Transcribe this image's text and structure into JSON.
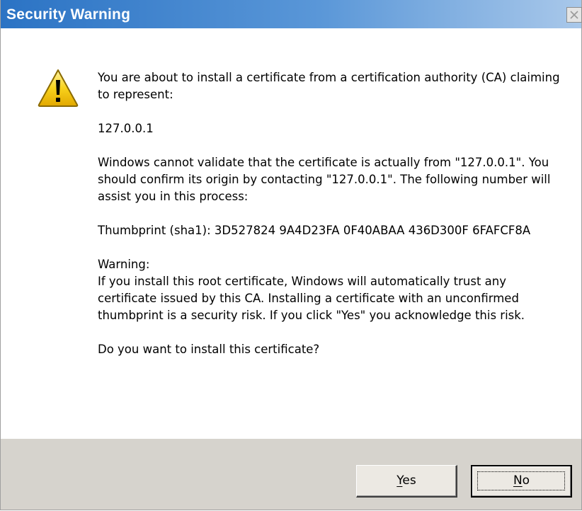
{
  "dialog": {
    "title": "Security Warning",
    "close_icon": "close-icon",
    "warning_icon": "warning-icon"
  },
  "message": {
    "intro": "You are about to install a certificate from a certification authority (CA) claiming to represent:",
    "subject": "127.0.0.1",
    "validation": "Windows cannot validate that the certificate is actually from \"127.0.0.1\". You should confirm its origin by contacting \"127.0.0.1\". The following number will assist you in this process:",
    "thumbprint": "Thumbprint (sha1): 3D527824 9A4D23FA 0F40ABAA 436D300F 6FAFCF8A",
    "warning_heading": "Warning:",
    "warning_body": "If you install this root certificate, Windows will automatically trust any certificate issued by this CA. Installing a certificate with an unconfirmed thumbprint is a security risk. If you click \"Yes\" you acknowledge this risk.",
    "question": "Do you want to install this certificate?"
  },
  "buttons": {
    "yes_accel": "Y",
    "yes_rest": "es",
    "no_accel": "N",
    "no_rest": "o",
    "default": "No"
  },
  "colors": {
    "title_bar_start": "#2b73c4",
    "title_bar_end": "#a9c8ea",
    "footer": "#d6d3cd",
    "warning_yellow": "#f5c800"
  }
}
